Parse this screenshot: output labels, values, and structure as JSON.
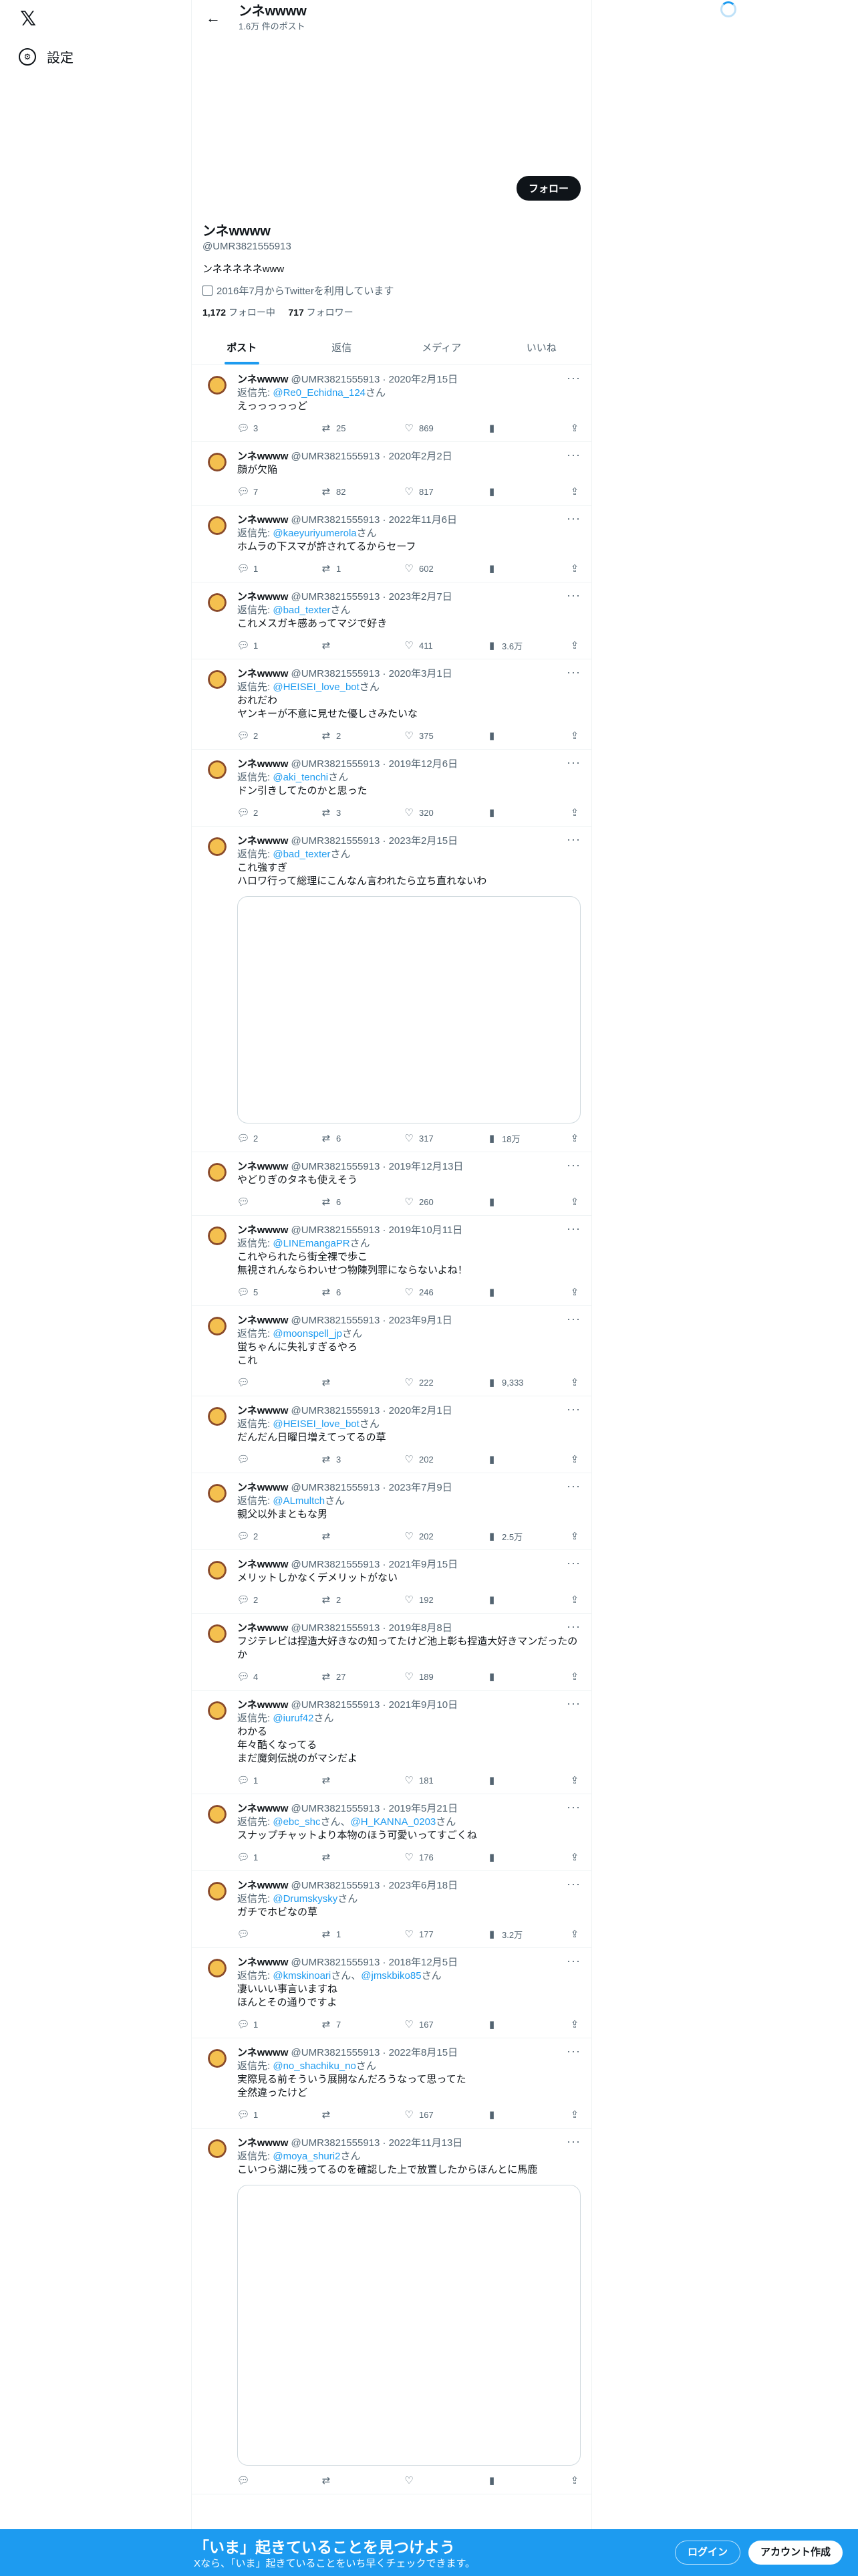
{
  "nav": {
    "logo": "𝕏",
    "settings_label": "設定"
  },
  "header": {
    "name": "ンネwwww",
    "post_count": "1.6万 件のポスト",
    "back_icon": "arrow-left-icon"
  },
  "profile": {
    "follow_label": "フォロー",
    "name": "ンネwwww",
    "handle": "@UMR3821555913",
    "bio": "ンネネネネネwww",
    "joined": "2016年7月からTwitterを利用しています",
    "following_count": "1,172",
    "following_label": "フォロー中",
    "followers_count": "717",
    "followers_label": "フォロワー"
  },
  "tabs": [
    "ポスト",
    "返信",
    "メディア",
    "いいね"
  ],
  "tweets": [
    {
      "name": "ンネwwww",
      "meta": "@UMR3821555913 · 2020年2月15日",
      "reply_to": [
        "@Re0_Echidna_124"
      ],
      "text": "えっっっっっど",
      "replies": "3",
      "retweets": "25",
      "likes": "869",
      "views": "",
      "media_height": 0
    },
    {
      "name": "ンネwwww",
      "meta": "@UMR3821555913 · 2020年2月2日",
      "reply_to": [],
      "text": "顔が欠陥",
      "replies": "7",
      "retweets": "82",
      "likes": "817",
      "views": "",
      "media_height": 0
    },
    {
      "name": "ンネwwww",
      "meta": "@UMR3821555913 · 2022年11月6日",
      "reply_to": [
        "@kaeyuriyumerola"
      ],
      "text": "ホムラの下スマが許されてるからセーフ",
      "replies": "1",
      "retweets": "1",
      "likes": "602",
      "views": "",
      "media_height": 0
    },
    {
      "name": "ンネwwww",
      "meta": "@UMR3821555913 · 2023年2月7日",
      "reply_to": [
        "@bad_texter"
      ],
      "text": "これメスガキ感あってマジで好き",
      "replies": "1",
      "retweets": "",
      "likes": "411",
      "views": "3.6万",
      "media_height": 0
    },
    {
      "name": "ンネwwww",
      "meta": "@UMR3821555913 · 2020年3月1日",
      "reply_to": [
        "@HEISEI_love_bot"
      ],
      "text": "おれだわ\nヤンキーが不意に見せた優しさみたいな",
      "replies": "2",
      "retweets": "2",
      "likes": "375",
      "views": "",
      "media_height": 0
    },
    {
      "name": "ンネwwww",
      "meta": "@UMR3821555913 · 2019年12月6日",
      "reply_to": [
        "@aki_tenchi"
      ],
      "text": "ドン引きしてたのかと思った",
      "replies": "2",
      "retweets": "3",
      "likes": "320",
      "views": "",
      "media_height": 0
    },
    {
      "name": "ンネwwww",
      "meta": "@UMR3821555913 · 2023年2月15日",
      "reply_to": [
        "@bad_texter"
      ],
      "text": "これ強すぎ\nハロワ行って総理にこんなん言われたら立ち直れないわ",
      "replies": "2",
      "retweets": "6",
      "likes": "317",
      "views": "18万",
      "media_height": 340
    },
    {
      "name": "ンネwwww",
      "meta": "@UMR3821555913 · 2019年12月13日",
      "reply_to": [],
      "text": "やどりぎのタネも使えそう",
      "replies": "",
      "retweets": "6",
      "likes": "260",
      "views": "",
      "media_height": 0
    },
    {
      "name": "ンネwwww",
      "meta": "@UMR3821555913 · 2019年10月11日",
      "reply_to": [
        "@LINEmangaPR"
      ],
      "text": "これやられたら街全裸で歩こ\n無視されんならわいせつ物陳列罪にならないよね！",
      "replies": "5",
      "retweets": "6",
      "likes": "246",
      "views": "",
      "media_height": 0
    },
    {
      "name": "ンネwwww",
      "meta": "@UMR3821555913 · 2023年9月1日",
      "reply_to": [
        "@moonspell_jp"
      ],
      "text": "蛍ちゃんに失礼すぎるやろ\nこれ",
      "replies": "",
      "retweets": "",
      "likes": "222",
      "views": "9,333",
      "media_height": 0
    },
    {
      "name": "ンネwwww",
      "meta": "@UMR3821555913 · 2020年2月1日",
      "reply_to": [
        "@HEISEI_love_bot"
      ],
      "text": "だんだん日曜日増えてってるの草",
      "replies": "",
      "retweets": "3",
      "likes": "202",
      "views": "",
      "media_height": 0
    },
    {
      "name": "ンネwwww",
      "meta": "@UMR3821555913 · 2023年7月9日",
      "reply_to": [
        "@ALmultch"
      ],
      "text": "親父以外まともな男",
      "replies": "2",
      "retweets": "",
      "likes": "202",
      "views": "2.5万",
      "media_height": 0
    },
    {
      "name": "ンネwwww",
      "meta": "@UMR3821555913 · 2021年9月15日",
      "reply_to": [],
      "text": "メリットしかなくデメリットがない",
      "replies": "2",
      "retweets": "2",
      "likes": "192",
      "views": "",
      "media_height": 0
    },
    {
      "name": "ンネwwww",
      "meta": "@UMR3821555913 · 2019年8月8日",
      "reply_to": [],
      "text": "フジテレビは捏造大好きなの知ってたけど池上彰も捏造大好きマンだったのか",
      "replies": "4",
      "retweets": "27",
      "likes": "189",
      "views": "",
      "media_height": 0
    },
    {
      "name": "ンネwwww",
      "meta": "@UMR3821555913 · 2021年9月10日",
      "reply_to": [
        "@iuruf42"
      ],
      "text": "わかる\n年々酷くなってる\nまだ魔剣伝説のがマシだよ",
      "replies": "1",
      "retweets": "",
      "likes": "181",
      "views": "",
      "media_height": 0
    },
    {
      "name": "ンネwwww",
      "meta": "@UMR3821555913 · 2019年5月21日",
      "reply_to": [
        "@ebc_shc",
        "@H_KANNA_0203"
      ],
      "text": "スナップチャットより本物のほう可愛いってすごくね",
      "replies": "1",
      "retweets": "",
      "likes": "176",
      "views": "",
      "media_height": 0
    },
    {
      "name": "ンネwwww",
      "meta": "@UMR3821555913 · 2023年6月18日",
      "reply_to": [
        "@Drumskysky"
      ],
      "text": "ガチでホビなの草",
      "replies": "",
      "retweets": "1",
      "likes": "177",
      "views": "3.2万",
      "media_height": 0
    },
    {
      "name": "ンネwwww",
      "meta": "@UMR3821555913 · 2018年12月5日",
      "reply_to": [
        "@kmskinoari",
        "@jmskbiko85"
      ],
      "text": "凄いいい事言いますね\nほんとその通りですよ",
      "replies": "1",
      "retweets": "7",
      "likes": "167",
      "views": "",
      "media_height": 0
    },
    {
      "name": "ンネwwww",
      "meta": "@UMR3821555913 · 2022年8月15日",
      "reply_to": [
        "@no_shachiku_no"
      ],
      "text": "実際見る前そういう展開なんだろうなって思ってた\n全然違ったけど",
      "replies": "1",
      "retweets": "",
      "likes": "167",
      "views": "",
      "media_height": 0
    },
    {
      "name": "ンネwwww",
      "meta": "@UMR3821555913 · 2022年11月13日",
      "reply_to": [
        "@moya_shuri2"
      ],
      "text": "こいつら湖に残ってるのを確認した上で放置したからほんとに馬鹿",
      "replies": "",
      "retweets": "",
      "likes": "",
      "views": "",
      "media_height": 420
    }
  ],
  "reply_prefix": "返信先: ",
  "reply_suffix": "さん",
  "bottom_bar": {
    "title": "「いま」起きていることを見つけよう",
    "subtitle": "Xなら、「いま」起きていることをいち早くチェックできます。",
    "login": "ログイン",
    "signup": "アカウント作成"
  }
}
